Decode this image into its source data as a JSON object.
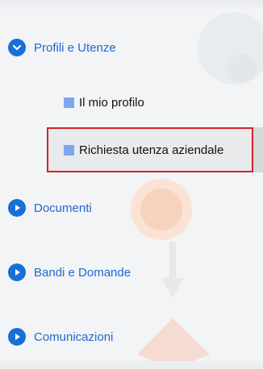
{
  "menu": {
    "profili": {
      "label": "Profili e Utenze",
      "expanded": true,
      "children": [
        {
          "label": "Il mio profilo"
        },
        {
          "label": "Richiesta utenza aziendale",
          "selected": true
        }
      ]
    },
    "documenti": {
      "label": "Documenti",
      "expanded": false
    },
    "bandi": {
      "label": "Bandi e Domande",
      "expanded": false
    },
    "comunicazioni": {
      "label": "Comunicazioni",
      "expanded": false
    }
  },
  "colors": {
    "accent": "#1a6fd6",
    "highlight": "#d0232b",
    "bullet": "#7fa6ee"
  },
  "icons": {
    "expanded": "chevron-down-icon",
    "collapsed": "play-right-icon",
    "bullet": "square-bullet-icon"
  }
}
